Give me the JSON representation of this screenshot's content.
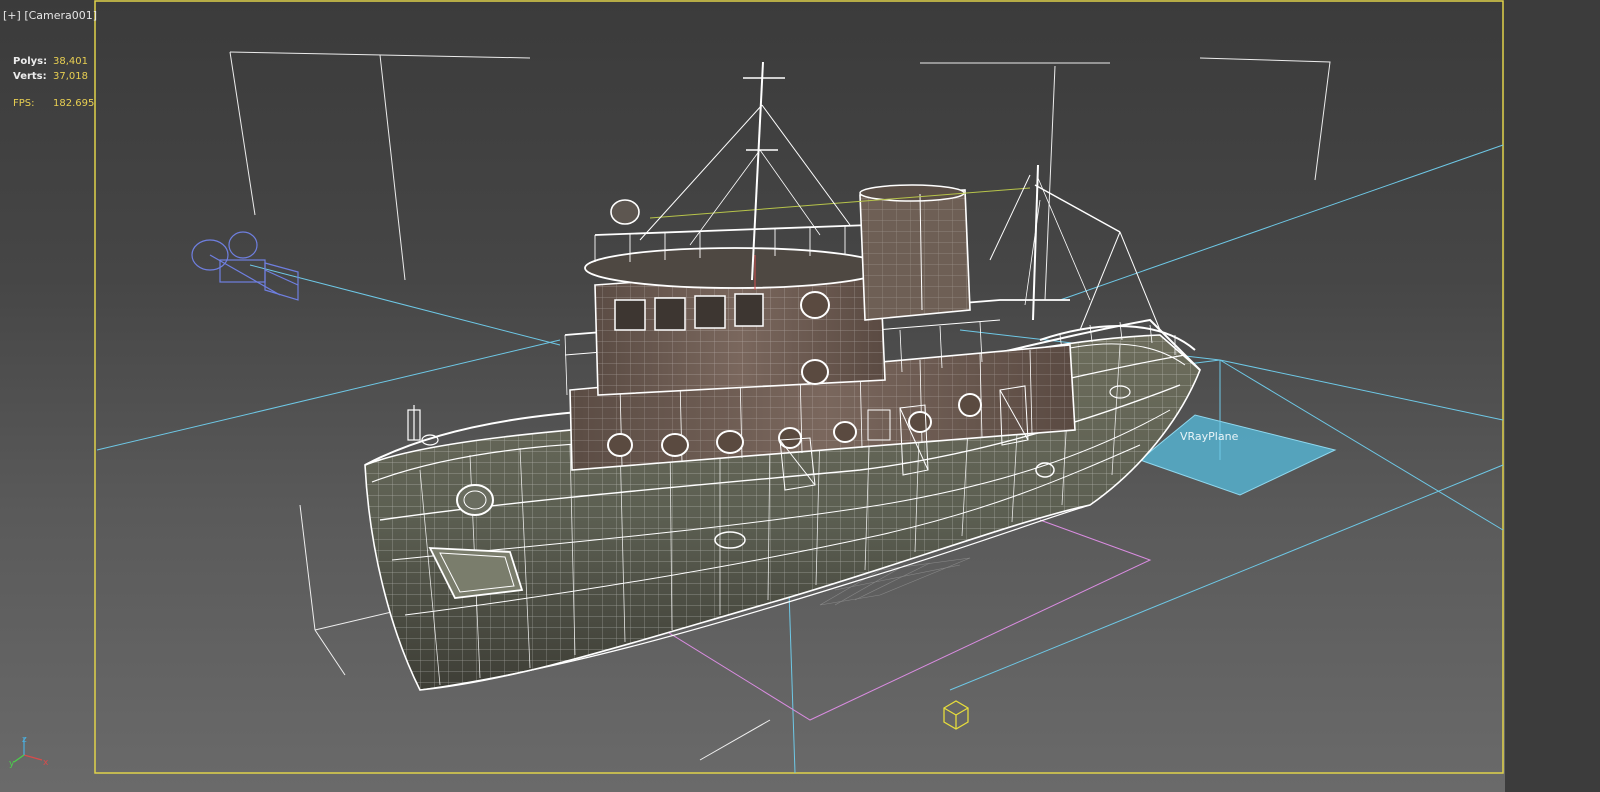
{
  "viewport": {
    "menu_label": "[+]",
    "camera_label": "[Camera001]"
  },
  "stats": {
    "polys_label": "Polys:",
    "polys_value": "38,401",
    "verts_label": "Verts:",
    "verts_value": "37,018",
    "fps_label": "FPS:",
    "fps_value": "182.695"
  },
  "scene": {
    "selected_object_label": "VRayPlane",
    "axis_labels": {
      "x": "x",
      "y": "y",
      "z": "z"
    }
  },
  "colors": {
    "active_viewport_border": "#e0d24a",
    "stat_value": "#e8cf52",
    "light_helper": "#6ec8e6",
    "wireframe": "#ffffff",
    "camera_icon": "#6f7fe0",
    "selection_box": "#d98ce0"
  },
  "icons": [
    "camera-icon",
    "helper-box-icon",
    "axis-tripod-icon"
  ]
}
